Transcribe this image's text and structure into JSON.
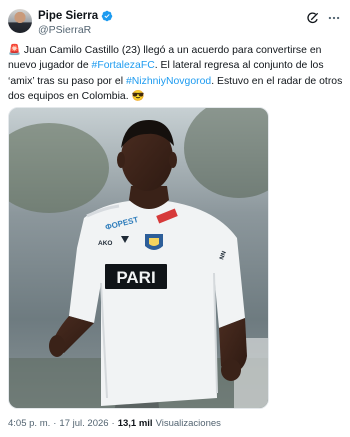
{
  "author": {
    "name": "Pipe Sierra",
    "handle": "@PSierraR"
  },
  "tweet": {
    "siren_emoji": "🚨",
    "part1": " Juan Camilo Castillo (23) llegó a un acuerdo para convertirse en nuevo jugador de ",
    "hashtag1": "#FortalezaFC",
    "part2": ". El lateral regresa al conjunto de los ‘amix’ tras su paso por el ",
    "hashtag2": "#NizhniyNovgorod",
    "part3": ". Estuvo en el radar de otros dos equipos en Colombia. ",
    "end_emoji": "😎"
  },
  "media": {
    "jersey_sponsor": "PARI",
    "jersey_brand": "AKO",
    "jersey_sleeve": "NN"
  },
  "meta": {
    "time": "4:05 p. m.",
    "sep1": "·",
    "date": "17 jul. 2026",
    "sep2": "·",
    "views_count": "13,1 mil",
    "views_label": "Visualizaciones"
  },
  "colors": {
    "accent": "#1d9bf0",
    "text": "#0f1419",
    "secondary": "#536471"
  },
  "icons": [
    "verified-badge-icon",
    "grok-icon",
    "more-options-icon"
  ]
}
